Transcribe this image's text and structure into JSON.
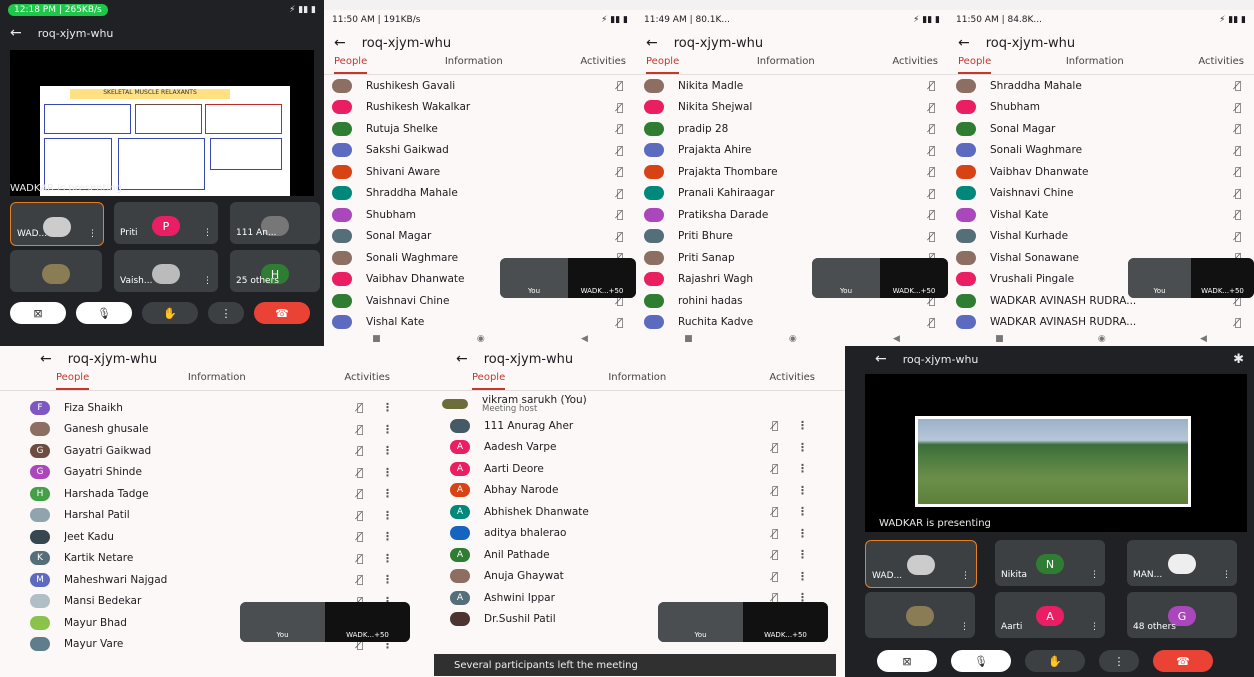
{
  "colors": {
    "accent": "#c0392b",
    "end": "#ea4335"
  },
  "common": {
    "title": "roq-xjym-whu",
    "tabs": [
      "People",
      "Information",
      "Activities"
    ]
  },
  "p1": {
    "status": "12:18 PM | 265KB/s",
    "title": "roq-xjym-whu",
    "slide_title": "SKELETAL MUSCLE RELAXANTS",
    "presenting": "WADKAR is presenting",
    "tiles": [
      {
        "label": "WAD...",
        "circle": ""
      },
      {
        "label": "Priti",
        "circle": "P"
      },
      {
        "label": "111 An...",
        "circle": ""
      },
      {
        "label": "",
        "circle": ""
      },
      {
        "label": "Vaish...",
        "circle": ""
      },
      {
        "label": "25 others",
        "circle": "H"
      }
    ]
  },
  "p2": {
    "status": "11:50 AM | 191KB/s",
    "people": [
      "Rushikesh Gavali",
      "Rushikesh Wakalkar",
      "Rutuja Shelke",
      "Sakshi Gaikwad",
      "Shivani Aware",
      "Shraddha Mahale",
      "Shubham",
      "Sonal Magar",
      "Sonali Waghmare",
      "Vaibhav Dhanwate",
      "Vaishnavi Chine",
      "Vishal Kate"
    ]
  },
  "p3": {
    "status": "11:49 AM | 80.1K...",
    "people": [
      "Nikita Madle",
      "Nikita Shejwal",
      "pradip 28",
      "Prajakta Ahire",
      "Prajakta Thombare",
      "Pranali Kahiraagar",
      "Pratiksha Darade",
      "Priti Bhure",
      "Priti Sanap",
      "Rajashri Wagh",
      "rohini hadas",
      "Ruchita Kadve"
    ]
  },
  "p4": {
    "status": "11:50 AM | 84.8K...",
    "people": [
      "Shraddha Mahale",
      "Shubham",
      "Sonal Magar",
      "Sonali Waghmare",
      "Vaibhav Dhanwate",
      "Vaishnavi Chine",
      "Vishal Kate",
      "Vishal Kurhade",
      "Vishal Sonawane",
      "Vrushali Pingale",
      "WADKAR AVINASH RUDRA...",
      "WADKAR AVINASH RUDRA..."
    ]
  },
  "p5": {
    "people": [
      {
        "name": "Fiza Shaikh",
        "init": "F",
        "color": "#7e57c2"
      },
      {
        "name": "Ganesh ghusale",
        "init": "",
        "color": "#8d6e63"
      },
      {
        "name": "Gayatri Gaikwad",
        "init": "G",
        "color": "#6d4c41"
      },
      {
        "name": "Gayatri Shinde",
        "init": "G",
        "color": "#ab47bc"
      },
      {
        "name": "Harshada Tadge",
        "init": "H",
        "color": "#43a047"
      },
      {
        "name": "Harshal Patil",
        "init": "",
        "color": "#90a4ae"
      },
      {
        "name": "Jeet Kadu",
        "init": "",
        "color": "#37474f"
      },
      {
        "name": "Kartik Netare",
        "init": "K",
        "color": "#546e7a"
      },
      {
        "name": "Maheshwari Najgad",
        "init": "M",
        "color": "#5c6bc0"
      },
      {
        "name": "Mansi Bedekar",
        "init": "",
        "color": "#b0bec5"
      },
      {
        "name": "Mayur Bhad",
        "init": "",
        "color": "#8bc34a"
      },
      {
        "name": "Mayur Vare",
        "init": "",
        "color": "#607d8b"
      }
    ]
  },
  "p6": {
    "host": "vikram sarukh (You)",
    "host_sub": "Meeting host",
    "people": [
      {
        "name": "111 Anurag Aher",
        "init": "",
        "color": "#455a64"
      },
      {
        "name": "Aadesh Varpe",
        "init": "A",
        "color": "#e91e63"
      },
      {
        "name": "Aarti Deore",
        "init": "A",
        "color": "#e91e63"
      },
      {
        "name": "Abhay Narode",
        "init": "A",
        "color": "#d84315"
      },
      {
        "name": "Abhishek Dhanwate",
        "init": "A",
        "color": "#00897b"
      },
      {
        "name": "aditya bhalerao",
        "init": "",
        "color": "#1565c0"
      },
      {
        "name": "Anil Pathade",
        "init": "A",
        "color": "#2e7d32"
      },
      {
        "name": "Anuja Ghaywat",
        "init": "",
        "color": "#8d6e63"
      },
      {
        "name": "Ashwini Ippar",
        "init": "A",
        "color": "#546e7a"
      },
      {
        "name": "Dr.Sushil Patil",
        "init": "",
        "color": "#4e342e"
      }
    ],
    "toast": "Several participants left the meeting"
  },
  "p7": {
    "title": "roq-xjym-whu",
    "presenting": "WADKAR is presenting",
    "tiles": [
      {
        "label": "WAD...",
        "circle": ""
      },
      {
        "label": "Nikita",
        "circle": "N"
      },
      {
        "label": "MAN...",
        "circle": ""
      },
      {
        "label": "",
        "circle": ""
      },
      {
        "label": "Aarti",
        "circle": "A"
      },
      {
        "label": "48 others",
        "circle": "G"
      }
    ]
  },
  "mini": {
    "you": "You",
    "wad": "WADK...+50"
  }
}
